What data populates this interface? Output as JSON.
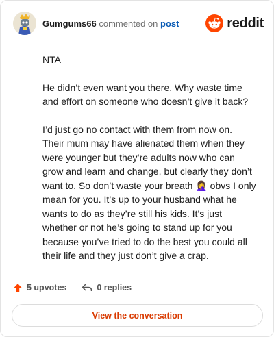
{
  "comment": {
    "username": "Gumgums66",
    "action_text": "commented on",
    "post_link": "post"
  },
  "brand": {
    "name": "reddit",
    "color": "#ff4500"
  },
  "body": {
    "paragraphs": [
      "NTA",
      "He didn’t even want you there. Why waste time and effort on someone who doesn’t give it back?",
      "I’d just go no contact with them from now on. Their mum may have alienated them when they were younger but they’re adults now who can grow and learn and change, but clearly they don’t want to. So don’t waste your breath 🤦‍♀️ obvs I only mean for you. It’s up to your husband what he wants to do as they’re still his kids. It’s just whether or not he’s going to stand up for you because you’ve tried to do the best you could all their life and they just don’t give a crap."
    ]
  },
  "actions": {
    "upvotes": "5 upvotes",
    "replies": "0 replies"
  },
  "cta": {
    "label": "View the conversation"
  },
  "colors": {
    "accent": "#d93a00",
    "upvote": "#ff4500",
    "link": "#0a5bb5"
  }
}
